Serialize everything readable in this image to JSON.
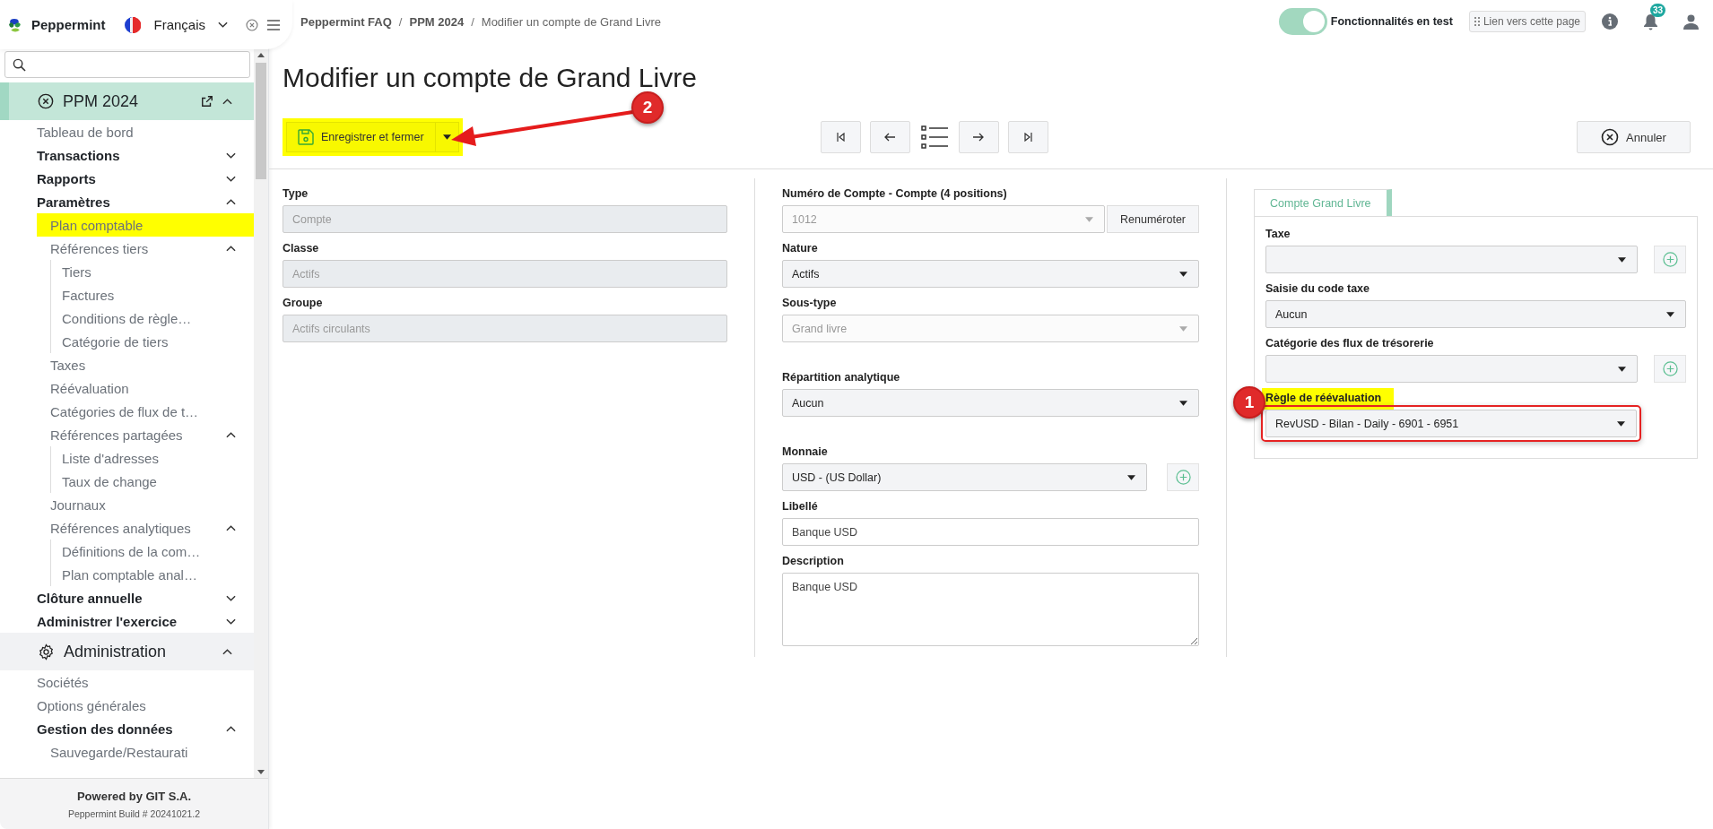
{
  "app": {
    "name": "Peppermint",
    "language": "Français"
  },
  "sidebar": {
    "groups": [
      {
        "title": "PPM 2024",
        "selected": true,
        "expanded": true,
        "items": [
          {
            "label": "Tableau de bord",
            "kind": "entry",
            "selected": false
          },
          {
            "label": "Transactions",
            "kind": "heading",
            "selected": false,
            "expanded": false
          },
          {
            "label": "Rapports",
            "kind": "heading",
            "selected": false,
            "expanded": false
          },
          {
            "label": "Paramètres",
            "kind": "heading",
            "selected": false,
            "expanded": true,
            "children": [
              {
                "label": "Plan comptable",
                "kind": "entry",
                "selected": true
              },
              {
                "label": "Références tiers",
                "kind": "entry",
                "selected": false,
                "expanded": true,
                "children": [
                  {
                    "label": "Tiers",
                    "kind": "entry",
                    "selected": false
                  },
                  {
                    "label": "Factures",
                    "kind": "entry",
                    "selected": false
                  },
                  {
                    "label": "Conditions de règle…",
                    "kind": "entry",
                    "selected": false
                  },
                  {
                    "label": "Catégorie de tiers",
                    "kind": "entry",
                    "selected": false
                  }
                ]
              },
              {
                "label": "Taxes",
                "kind": "entry",
                "selected": false
              },
              {
                "label": "Réévaluation",
                "kind": "entry",
                "selected": false
              },
              {
                "label": "Catégories de flux de t…",
                "kind": "entry",
                "selected": false
              },
              {
                "label": "Références partagées",
                "kind": "entry",
                "selected": false,
                "expanded": true,
                "children": [
                  {
                    "label": "Liste d'adresses",
                    "kind": "entry",
                    "selected": false
                  },
                  {
                    "label": "Taux de change",
                    "kind": "entry",
                    "selected": false
                  }
                ]
              },
              {
                "label": "Journaux",
                "kind": "entry",
                "selected": false
              },
              {
                "label": "Références analytiques",
                "kind": "entry",
                "selected": false,
                "expanded": true,
                "children": [
                  {
                    "label": "Définitions de la com…",
                    "kind": "entry",
                    "selected": false
                  },
                  {
                    "label": "Plan comptable anal…",
                    "kind": "entry",
                    "selected": false
                  }
                ]
              }
            ]
          },
          {
            "label": "Clôture annuelle",
            "kind": "heading",
            "selected": false,
            "expanded": false
          },
          {
            "label": "Administrer l'exercice",
            "kind": "heading",
            "selected": false,
            "expanded": false
          }
        ]
      },
      {
        "title": "Administration",
        "selected": false,
        "expanded": true,
        "items": [
          {
            "label": "Sociétés",
            "kind": "entry",
            "selected": false
          },
          {
            "label": "Options générales",
            "kind": "entry",
            "selected": false
          },
          {
            "label": "Gestion des données",
            "kind": "heading",
            "selected": false,
            "expanded": true,
            "children": [
              {
                "label": "Sauvegarde/Restaurati",
                "kind": "entry",
                "selected": false
              }
            ]
          }
        ]
      }
    ],
    "footer": {
      "powered_by": "Powered by GIT S.A.",
      "build": "Peppermint Build # 20241021.2"
    }
  },
  "breadcrumb": [
    {
      "kind": "link",
      "text": "Peppermint FAQ"
    },
    {
      "kind": "separator",
      "text": "/"
    },
    {
      "kind": "link",
      "text": "PPM 2024"
    },
    {
      "kind": "separator",
      "text": "/"
    },
    {
      "kind": "current",
      "text": "Modifier un compte de Grand Livre"
    }
  ],
  "topbar": {
    "toggle": {
      "label": "Fonctionnalités en test",
      "on": true
    },
    "link": "Lien vers cette page",
    "notifications": "33"
  },
  "page_title": "Modifier un compte de Grand Livre",
  "toolbar": {
    "save": "Enregistrer et fermer",
    "save_highlight": true,
    "marker": "2",
    "cancel": "Annuler"
  },
  "columns": [
    {
      "fields": [
        {
          "label": "Type",
          "kind": "text",
          "value": "Compte",
          "disabled": true
        },
        {
          "label": "Classe",
          "kind": "text",
          "value": "Actifs",
          "disabled": true
        },
        {
          "label": "Groupe",
          "kind": "text",
          "value": "Actifs circulants",
          "disabled": true
        }
      ]
    },
    {
      "fields": [
        {
          "label": "Numéro de Compte - Compte (4 positions)",
          "kind": "select",
          "value": "1012",
          "disabled": true,
          "action": "Renuméroter"
        },
        {
          "label": "Nature",
          "kind": "select",
          "value": "Actifs",
          "disabled": false
        },
        {
          "label": "Sous-type",
          "kind": "select",
          "value": "Grand livre",
          "disabled": true
        },
        {
          "label": "Répartition analytique",
          "kind": "select",
          "value": "Aucun",
          "disabled": false
        },
        {
          "label": "Monnaie",
          "kind": "select",
          "value": "USD - (US Dollar)",
          "disabled": false,
          "add": true
        },
        {
          "label": "Libellé",
          "kind": "text",
          "value": "Banque USD",
          "disabled": false
        },
        {
          "label": "Description",
          "kind": "textarea",
          "value": "Banque USD",
          "disabled": false
        }
      ]
    },
    {
      "tabs": [
        {
          "label": "Compte Grand Livre",
          "selected": true
        }
      ],
      "fields": [
        {
          "label": "Taxe",
          "kind": "select",
          "disabled": false,
          "add": true
        },
        {
          "label": "Saisie du code taxe",
          "kind": "select",
          "value": "Aucun",
          "disabled": false
        },
        {
          "label": "Catégorie des flux de trésorerie",
          "kind": "select",
          "disabled": false,
          "add": true
        },
        {
          "label": "Règle de réévaluation",
          "kind": "select",
          "value": "RevUSD - Bilan - Daily - 6901 - 6951",
          "disabled": false,
          "highlight": true,
          "marker": "1"
        }
      ]
    }
  ]
}
